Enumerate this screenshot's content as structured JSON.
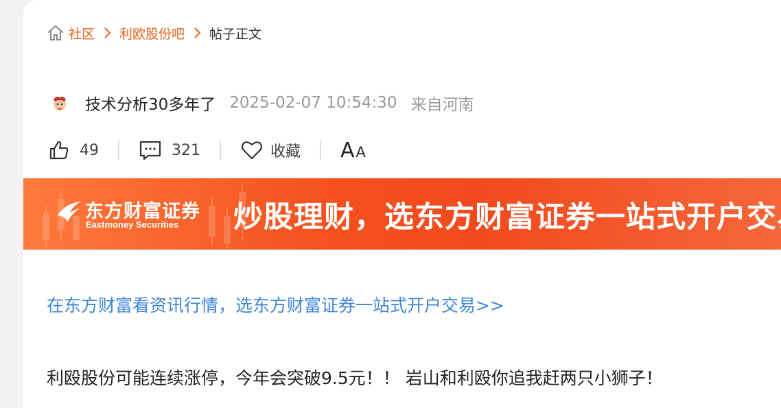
{
  "breadcrumb": {
    "home": "社区",
    "forum": "利欧股份吧",
    "current": "帖子正文"
  },
  "post": {
    "author": "技术分析30多年了",
    "time": "2025-02-07 10:54:30",
    "location": "来自河南",
    "likes": "49",
    "comments": "321",
    "favorite_label": "收藏",
    "font_large": "A",
    "font_small": "A"
  },
  "banner": {
    "brand_cn": "东方财富证券",
    "brand_en": "Eastmoney Securities",
    "slogan": "炒股理财，选东方财富证券一站式开户交易"
  },
  "content": {
    "promo_link": "在东方财富看资讯行情，选东方财富证券一站式开户交易>>",
    "body": "利殴股份可能连续涨停，今年会突破9.5元！！ 岩山和利殴你追我赶两只小狮子！"
  },
  "colors": {
    "accent": "#e8611a",
    "link": "#3f86d8",
    "banner": "#f24a1d"
  }
}
